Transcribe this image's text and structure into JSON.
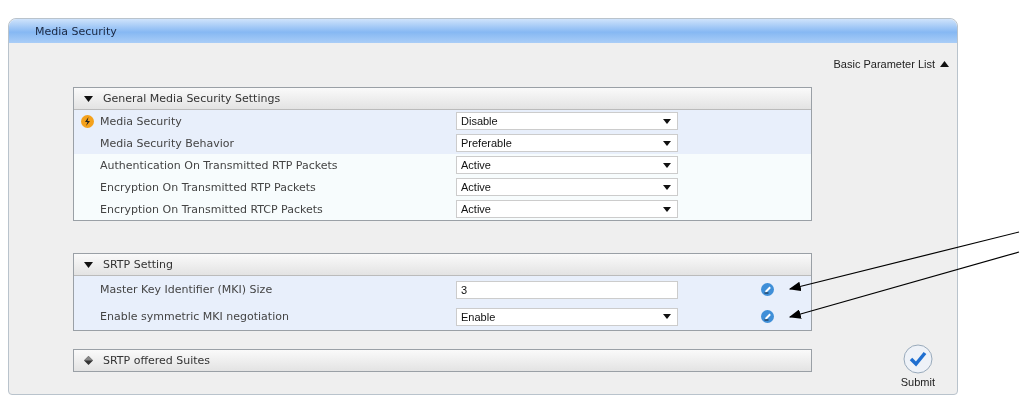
{
  "panel": {
    "title": "Media Security",
    "list_toggle": {
      "label": "Basic Parameter List",
      "expanded": true
    }
  },
  "groups": [
    {
      "title": "General Media Security Settings",
      "expanded": true,
      "rows": [
        {
          "label": "Media Security",
          "kind": "select",
          "value": "Disable",
          "highlighted": true,
          "warning": true,
          "edited": false
        },
        {
          "label": "Media Security Behavior",
          "kind": "select",
          "value": "Preferable",
          "highlighted": true,
          "warning": false,
          "edited": false
        },
        {
          "label": "Authentication On Transmitted RTP Packets",
          "kind": "select",
          "value": "Active",
          "highlighted": false,
          "warning": false,
          "edited": false
        },
        {
          "label": "Encryption On Transmitted RTP Packets",
          "kind": "select",
          "value": "Active",
          "highlighted": false,
          "warning": false,
          "edited": false
        },
        {
          "label": "Encryption On Transmitted RTCP Packets",
          "kind": "select",
          "value": "Active",
          "highlighted": false,
          "warning": false,
          "edited": false
        }
      ]
    },
    {
      "title": "SRTP Setting",
      "expanded": true,
      "rows": [
        {
          "label": "Master Key Identifier (MKI) Size",
          "kind": "text",
          "value": "3",
          "highlighted": true,
          "warning": false,
          "edited": true
        },
        {
          "label": "Enable symmetric MKI negotiation",
          "kind": "select",
          "value": "Enable",
          "highlighted": true,
          "warning": false,
          "edited": true
        }
      ]
    },
    {
      "title": "SRTP offered Suites",
      "expanded": false
    }
  ],
  "submit": {
    "label": "Submit"
  }
}
